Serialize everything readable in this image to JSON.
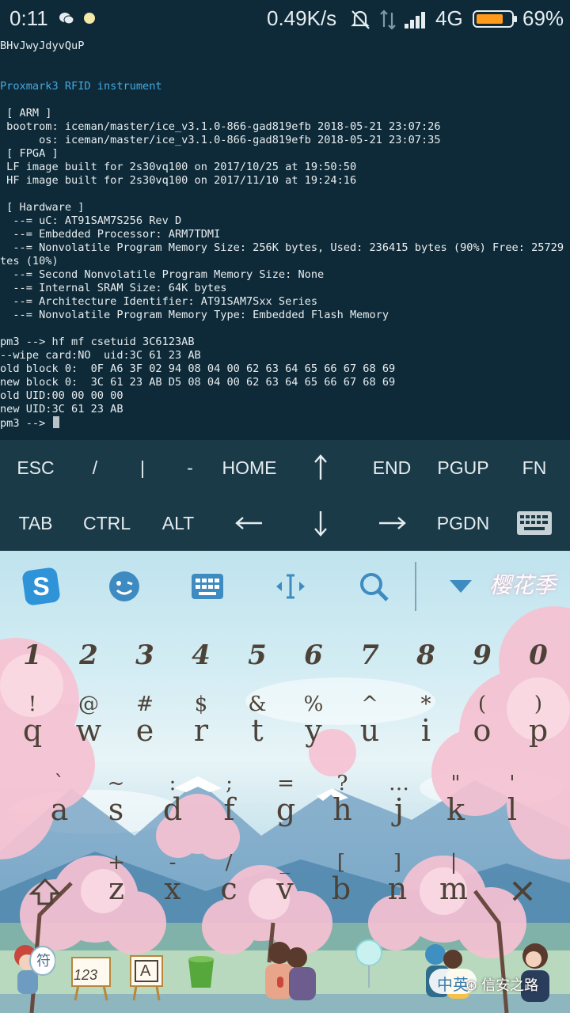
{
  "status_bar": {
    "time": "0:11",
    "net_speed": "0.49K/s",
    "network": "4G",
    "battery_percent": "69%",
    "battery_level": 0.69,
    "icons": [
      "wechat-icon",
      "notification-dot-icon",
      "mute-icon",
      "data-transfer-icon",
      "signal-icon",
      "battery-icon"
    ]
  },
  "terminal": {
    "lines": [
      "BHvJwyJdyvQuP",
      "",
      "",
      "Proxmark3 RFID instrument",
      "",
      " [ ARM ]",
      " bootrom: iceman/master/ice_v3.1.0-866-gad819efb 2018-05-21 23:07:26",
      "      os: iceman/master/ice_v3.1.0-866-gad819efb 2018-05-21 23:07:35",
      " [ FPGA ]",
      " LF image built for 2s30vq100 on 2017/10/25 at 19:50:50",
      " HF image built for 2s30vq100 on 2017/11/10 at 19:24:16",
      "",
      " [ Hardware ]",
      "  --= uC: AT91SAM7S256 Rev D",
      "  --= Embedded Processor: ARM7TDMI",
      "  --= Nonvolatile Program Memory Size: 256K bytes, Used: 236415 bytes (90%) Free: 25729 by",
      "tes (10%)",
      "  --= Second Nonvolatile Program Memory Size: None",
      "  --= Internal SRAM Size: 64K bytes",
      "  --= Architecture Identifier: AT91SAM7Sxx Series",
      "  --= Nonvolatile Program Memory Type: Embedded Flash Memory",
      "",
      "pm3 --> hf mf csetuid 3C6123AB",
      "--wipe card:NO  uid:3C 61 23 AB",
      "old block 0:  0F A6 3F 02 94 08 04 00 62 63 64 65 66 67 68 69",
      "new block 0:  3C 61 23 AB D5 08 04 00 62 63 64 65 66 67 68 69",
      "old UID:00 00 00 00",
      "new UID:3C 61 23 AB",
      "pm3 --> "
    ],
    "accent_color": "#45a8e0"
  },
  "extra_keys": {
    "row1": [
      "ESC",
      "/",
      "|",
      "-",
      "HOME",
      "",
      "END",
      "PGUP",
      "FN"
    ],
    "row2": [
      "TAB",
      "CTRL",
      "ALT",
      "",
      "",
      "",
      "PGDN",
      ""
    ],
    "arrows": [
      "arrow-up-icon",
      "arrow-down-icon",
      "arrow-left-icon",
      "arrow-right-icon"
    ]
  },
  "ime": {
    "brand": "樱花季",
    "toolbar_icons": [
      "sogou-logo-icon",
      "emoji-icon",
      "keyboard-icon",
      "cursor-move-icon",
      "search-icon",
      "collapse-icon"
    ],
    "digits": [
      "1",
      "2",
      "3",
      "4",
      "5",
      "6",
      "7",
      "8",
      "9",
      "0"
    ],
    "row_q": [
      {
        "hint": "!",
        "main": "q"
      },
      {
        "hint": "@",
        "main": "w"
      },
      {
        "hint": "#",
        "main": "e"
      },
      {
        "hint": "$",
        "main": "r"
      },
      {
        "hint": "&",
        "main": "t"
      },
      {
        "hint": "%",
        "main": "y"
      },
      {
        "hint": "^",
        "main": "u"
      },
      {
        "hint": "*",
        "main": "i"
      },
      {
        "hint": "(",
        "main": "o"
      },
      {
        "hint": ")",
        "main": "p"
      }
    ],
    "row_a": [
      {
        "hint": "`",
        "main": "a"
      },
      {
        "hint": "~",
        "main": "s"
      },
      {
        "hint": ":",
        "main": "d"
      },
      {
        "hint": ";",
        "main": "f"
      },
      {
        "hint": "=",
        "main": "g"
      },
      {
        "hint": "?",
        "main": "h"
      },
      {
        "hint": "…",
        "main": "j"
      },
      {
        "hint": "\"",
        "main": "k"
      },
      {
        "hint": "'",
        "main": "l"
      }
    ],
    "row_z": [
      {
        "hint": "+",
        "main": "z"
      },
      {
        "hint": "-",
        "main": "x"
      },
      {
        "hint": "/",
        "main": "c"
      },
      {
        "hint": "_",
        "main": "v"
      },
      {
        "hint": "[",
        "main": "b"
      },
      {
        "hint": "]",
        "main": "n"
      },
      {
        "hint": "|",
        "main": "m"
      }
    ],
    "dock": {
      "symbol_key": "符",
      "number_key": "123",
      "letter_key": "A",
      "lang_key": "中英"
    },
    "watermark": "信安之路"
  }
}
